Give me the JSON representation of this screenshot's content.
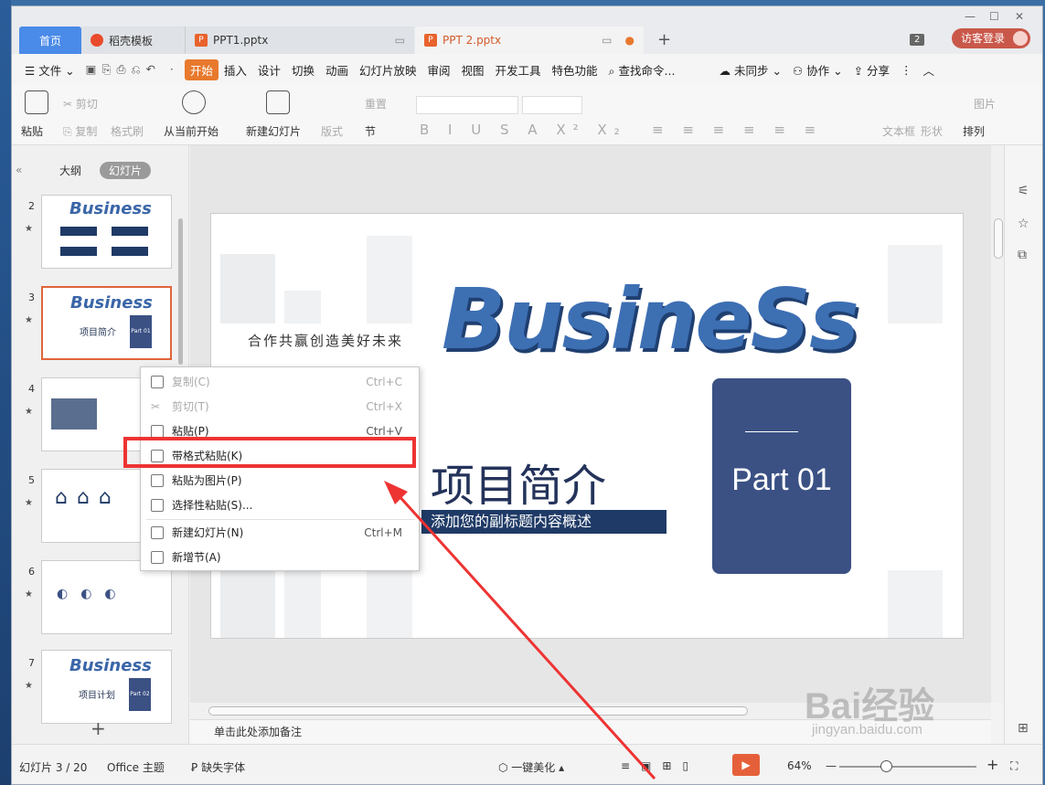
{
  "tabs": {
    "home": "首页",
    "t1": "稻壳模板",
    "t2": "PPT1.pptx",
    "t3": "PPT 2.pptx",
    "count": "2",
    "login": "访客登录"
  },
  "menu": {
    "file": "文件",
    "items": [
      "开始",
      "插入",
      "设计",
      "切换",
      "动画",
      "幻灯片放映",
      "审阅",
      "视图",
      "开发工具",
      "特色功能"
    ],
    "search": "查找命令...",
    "sync": "未同步",
    "collab": "协作",
    "share": "分享"
  },
  "ribbon": {
    "paste": "粘贴",
    "cut": "剪切",
    "copy": "复制",
    "format_painter": "格式刷",
    "play_from_current": "从当前开始",
    "new_slide": "新建幻灯片",
    "layout": "版式",
    "section": "节",
    "reset": "重置",
    "textbox": "文本框",
    "shape": "形状",
    "arrange": "排列",
    "picture": "图片"
  },
  "panel": {
    "outline": "大纲",
    "slides": "幻灯片"
  },
  "thumbs": [
    {
      "num": "2"
    },
    {
      "num": "3",
      "title": "项目简介",
      "part": "Part 01"
    },
    {
      "num": "4"
    },
    {
      "num": "5"
    },
    {
      "num": "6"
    },
    {
      "num": "7",
      "title": "项目计划",
      "part": "Part 02"
    }
  ],
  "thumb_word": "Business",
  "slide": {
    "slogan": "合作共赢创造美好未来",
    "word": "BusineSs",
    "title": "项目简介",
    "subtitle": "添加您的副标题内容概述",
    "part": "Part 01"
  },
  "context_menu": [
    {
      "label": "复制(C)",
      "key": "Ctrl+C",
      "disabled": true
    },
    {
      "label": "剪切(T)",
      "key": "Ctrl+X",
      "disabled": true
    },
    {
      "label": "粘贴(P)",
      "key": "Ctrl+V",
      "disabled": false
    },
    {
      "label": "带格式粘贴(K)",
      "key": "",
      "disabled": false
    },
    {
      "label": "粘贴为图片(P)",
      "key": "",
      "disabled": false
    },
    {
      "label": "选择性粘贴(S)...",
      "key": "",
      "disabled": false
    },
    {
      "label": "新建幻灯片(N)",
      "key": "Ctrl+M",
      "disabled": false
    },
    {
      "label": "新增节(A)",
      "key": "",
      "disabled": false
    }
  ],
  "notes": "单击此处添加备注",
  "status": {
    "slide_count": "幻灯片 3 / 20",
    "theme": "Office 主题",
    "missing_font": "缺失字体",
    "beautify": "一键美化",
    "zoom": "64%"
  },
  "watermark": {
    "brand": "Bai经验",
    "url": "jingyan.baidu.com"
  },
  "colors": {
    "accent": "#e8792d",
    "highlight": "#ee3333",
    "slide_navy": "#3b5184"
  }
}
